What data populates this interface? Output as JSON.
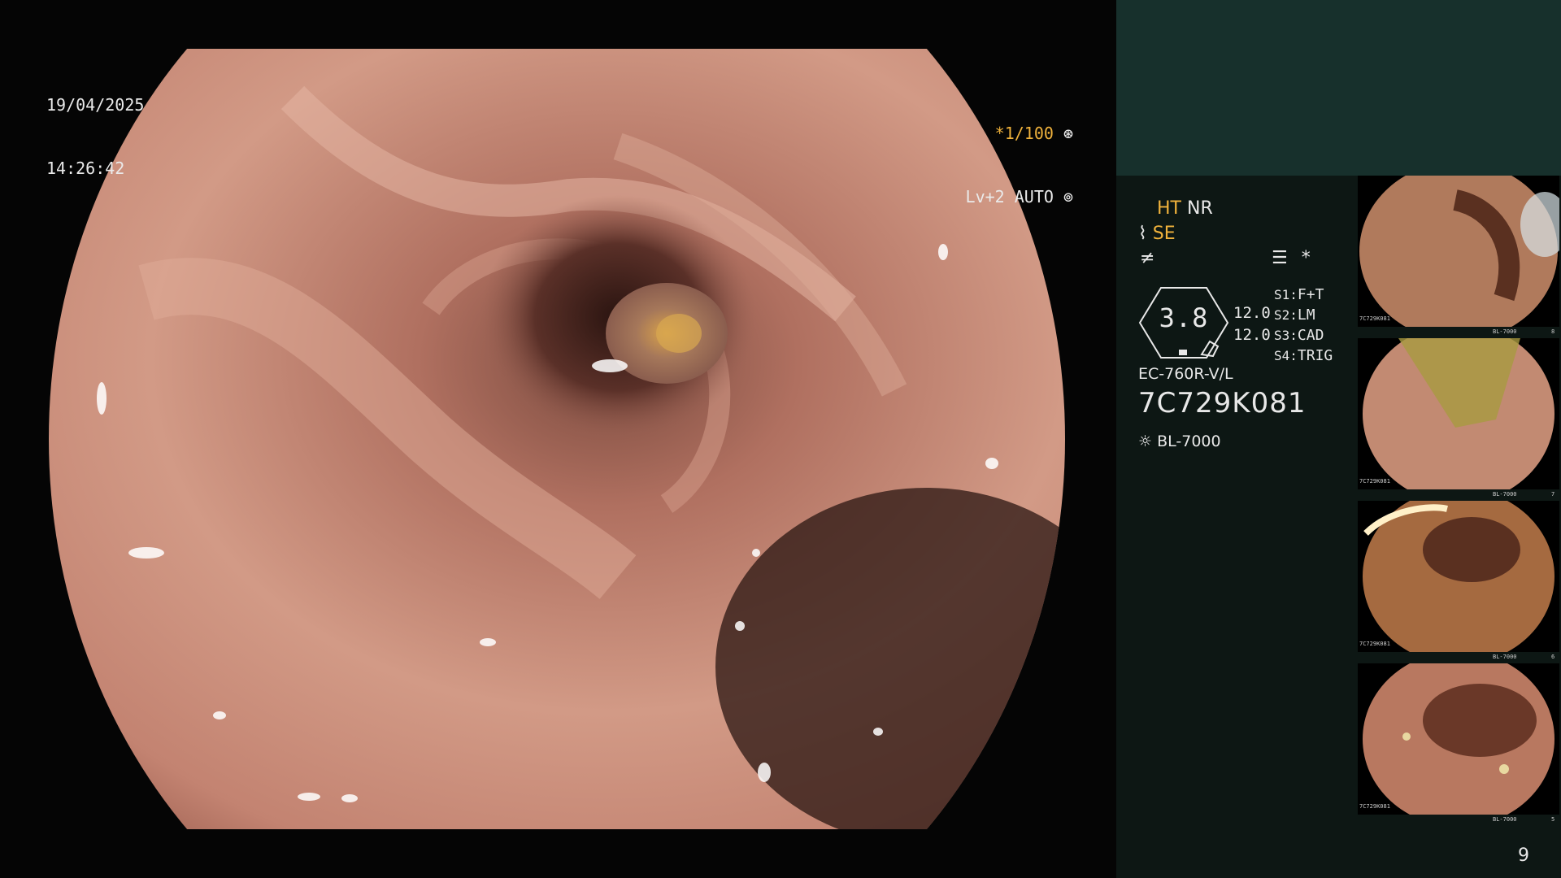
{
  "overlay": {
    "date": "19/04/2025",
    "time": "14:26:42",
    "shutter": "*1/100",
    "iris": "Lv+2 AUTO"
  },
  "panel": {
    "mode_ht": "HT",
    "mode_nr": "NR",
    "mode_se": "SE",
    "star": "*",
    "zoom_value": "3.8",
    "value_1": "12.0",
    "value_2": "12.0",
    "switches": [
      {
        "label": "S1:",
        "value": "F+T"
      },
      {
        "label": "S2:",
        "value": "LM"
      },
      {
        "label": "S3:",
        "value": "CAD"
      },
      {
        "label": "S4:",
        "value": "TRIG"
      }
    ],
    "scope_model": "EC-760R-V/L",
    "serial": "7C729K081",
    "light_source": "BL-7000",
    "page_number": "9"
  },
  "thumbnails": [
    {
      "id": "thumb-1",
      "serial": "7C729K081",
      "light": "BL-7000",
      "index": "8"
    },
    {
      "id": "thumb-2",
      "serial": "7C729K081",
      "light": "BL-7000",
      "index": "7"
    },
    {
      "id": "thumb-3",
      "serial": "7C729K081",
      "light": "BL-7000",
      "index": "6"
    },
    {
      "id": "thumb-4",
      "serial": "7C729K081",
      "light": "BL-7000",
      "index": "5"
    }
  ],
  "colors": {
    "panel_bg": "#0d1714",
    "panel_header": "#17302c",
    "accent_amber": "#f0b23c",
    "mucosa": "#c98a78"
  },
  "icons": [
    "shutter-icon",
    "iris-icon",
    "structure-enhance-icon",
    "color-icon",
    "menu-icon",
    "lamp-icon"
  ]
}
